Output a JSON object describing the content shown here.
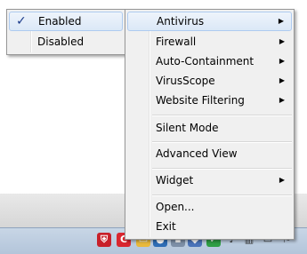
{
  "submenu": {
    "items": [
      {
        "label": "Enabled",
        "check": "✓"
      },
      {
        "label": "Disabled"
      }
    ]
  },
  "menu": {
    "items": [
      {
        "label": "Antivirus",
        "arrow": "▶"
      },
      {
        "label": "Firewall",
        "arrow": "▶"
      },
      {
        "label": "Auto-Containment",
        "arrow": "▶"
      },
      {
        "label": "VirusScope",
        "arrow": "▶"
      },
      {
        "label": "Website Filtering",
        "arrow": "▶"
      },
      {
        "label": "Silent Mode"
      },
      {
        "label": "Advanced View"
      },
      {
        "label": "Widget",
        "arrow": "▶"
      },
      {
        "label": "Open..."
      },
      {
        "label": "Exit"
      }
    ]
  },
  "tray": {
    "icons": [
      "comodo-icon",
      "comodo-red-icon",
      "folder-icon",
      "blue-tray-icon",
      "drive-icon",
      "green-check-icon",
      "speaker-icon",
      "network-icon",
      "monitor-icon",
      "action-center-icon"
    ]
  }
}
